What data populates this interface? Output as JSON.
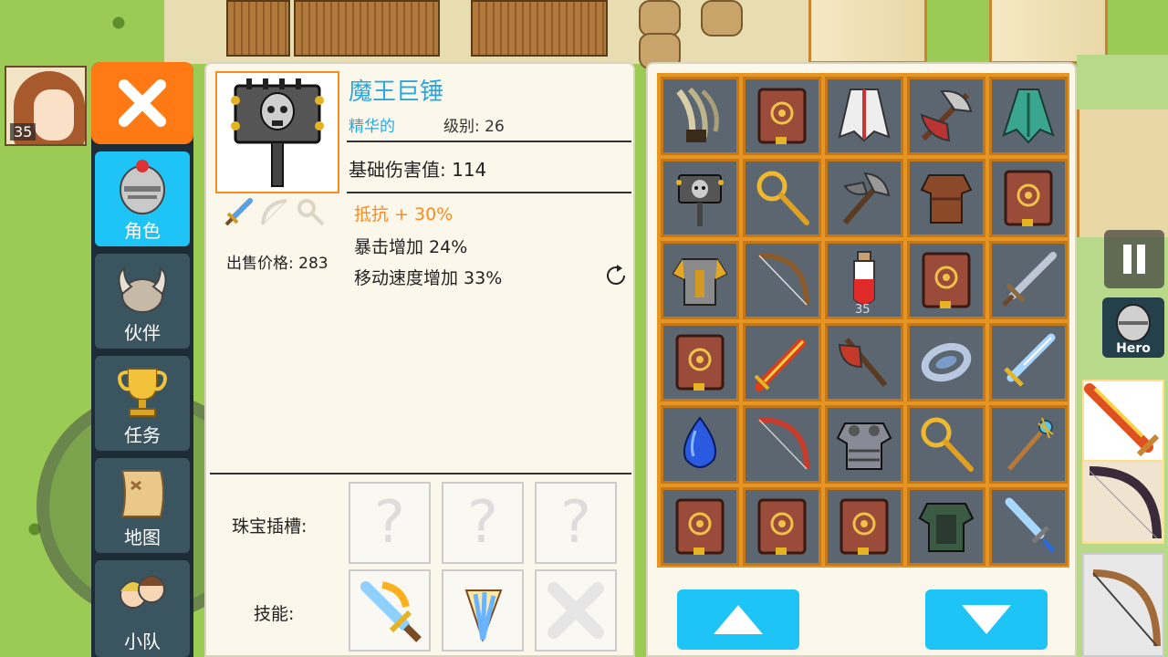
{
  "hero": {
    "level": "35"
  },
  "menu": {
    "close_icon": "close-icon",
    "items": [
      {
        "label": "角色",
        "icon": "knight-helmet-icon",
        "active": true
      },
      {
        "label": "伙伴",
        "icon": "horned-helmet-icon",
        "active": false
      },
      {
        "label": "任务",
        "icon": "trophy-icon",
        "active": false
      },
      {
        "label": "地图",
        "icon": "map-scroll-icon",
        "active": false
      },
      {
        "label": "小队",
        "icon": "party-icon",
        "active": false
      }
    ]
  },
  "item": {
    "name": "魔王巨锤",
    "quality": "精华的",
    "level": "级别: 26",
    "base_damage": "基础伤害值: 114",
    "attributes": [
      "抵抗 + 30%",
      "暴击增加 24%",
      "移动速度增加 33%"
    ],
    "sell_price": "出售价格: 283"
  },
  "sockets": {
    "gem_label": "珠宝插槽:",
    "gem_slots": [
      "?",
      "?",
      "?"
    ],
    "skill_label": "技能:"
  },
  "inventory": {
    "items": [
      {
        "icon": "claw-icon"
      },
      {
        "icon": "spellbook-icon"
      },
      {
        "icon": "cloak-icon"
      },
      {
        "icon": "battle-axe-icon"
      },
      {
        "icon": "green-cloak-icon"
      },
      {
        "icon": "demon-hammer-icon"
      },
      {
        "icon": "magnifier-staff-icon"
      },
      {
        "icon": "axe-icon"
      },
      {
        "icon": "leather-armor-icon"
      },
      {
        "icon": "spellbook-icon"
      },
      {
        "icon": "gold-armor-icon"
      },
      {
        "icon": "bow-icon"
      },
      {
        "icon": "potion-icon",
        "count": "35"
      },
      {
        "icon": "spellbook-icon"
      },
      {
        "icon": "sword-icon"
      },
      {
        "icon": "spellbook-icon"
      },
      {
        "icon": "flame-sword-icon"
      },
      {
        "icon": "red-axe-icon"
      },
      {
        "icon": "silver-ring-icon"
      },
      {
        "icon": "blue-sword-icon"
      },
      {
        "icon": "sapphire-icon"
      },
      {
        "icon": "red-bow-icon"
      },
      {
        "icon": "plate-armor-icon"
      },
      {
        "icon": "magnifier-staff-icon"
      },
      {
        "icon": "wand-icon"
      },
      {
        "icon": "spellbook-icon"
      },
      {
        "icon": "spellbook-icon"
      },
      {
        "icon": "spellbook-icon"
      },
      {
        "icon": "dark-armor-icon"
      },
      {
        "icon": "ice-dagger-icon"
      }
    ],
    "up_icon": "arrow-up-icon",
    "down_icon": "arrow-down-icon"
  },
  "hud": {
    "pause_icon": "pause-icon",
    "hero_label": "Hero"
  },
  "colors": {
    "accent_orange": "#ff7a14",
    "accent_blue": "#1ec4f5",
    "grid_orange": "#e69422",
    "cell_gray": "#5b6670",
    "attr_orange": "#ff8a1e",
    "name_blue": "#29a8e0"
  }
}
